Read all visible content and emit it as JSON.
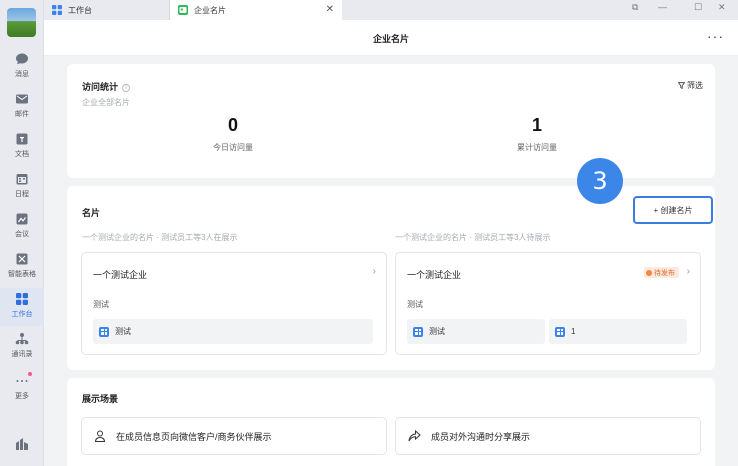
{
  "tabs": [
    {
      "label": "工作台"
    },
    {
      "label": "企业名片"
    }
  ],
  "header": {
    "title": "企业名片",
    "more": "···"
  },
  "sidebar": {
    "items": [
      {
        "label": "消息"
      },
      {
        "label": "邮件"
      },
      {
        "label": "文档"
      },
      {
        "label": "日程"
      },
      {
        "label": "会议"
      },
      {
        "label": "智能表格"
      },
      {
        "label": "工作台"
      },
      {
        "label": "通讯录"
      },
      {
        "label": "更多"
      }
    ]
  },
  "stats_card": {
    "title": "访问统计",
    "subtitle": "企业全部名片",
    "filter": "筛选",
    "today_value": "0",
    "today_label": "今日访问量",
    "total_value": "1",
    "total_label": "累计访问量"
  },
  "cards_section": {
    "title": "名片",
    "create_button": "+ 创建名片",
    "step_badge": "3",
    "cards": [
      {
        "caption": "一个测试企业的名片 · 测试员工等3人在展示",
        "company": "一个测试企业",
        "desc": "测试",
        "items": [
          "测试"
        ]
      },
      {
        "caption": "一个测试企业的名片 · 测试员工等3人待展示",
        "company": "一个测试企业",
        "status": "待发布",
        "desc": "测试",
        "items": [
          "测试",
          "1"
        ]
      }
    ]
  },
  "scenes_section": {
    "title": "展示场景",
    "scenes": [
      {
        "label": "在成员信息页向微信客户/商务伙伴展示"
      },
      {
        "label": "成员对外沟通时分享展示"
      }
    ]
  },
  "colors": {
    "accent": "#3a7de0",
    "badge": "#3c86ea",
    "pending": "#e36a2a"
  }
}
